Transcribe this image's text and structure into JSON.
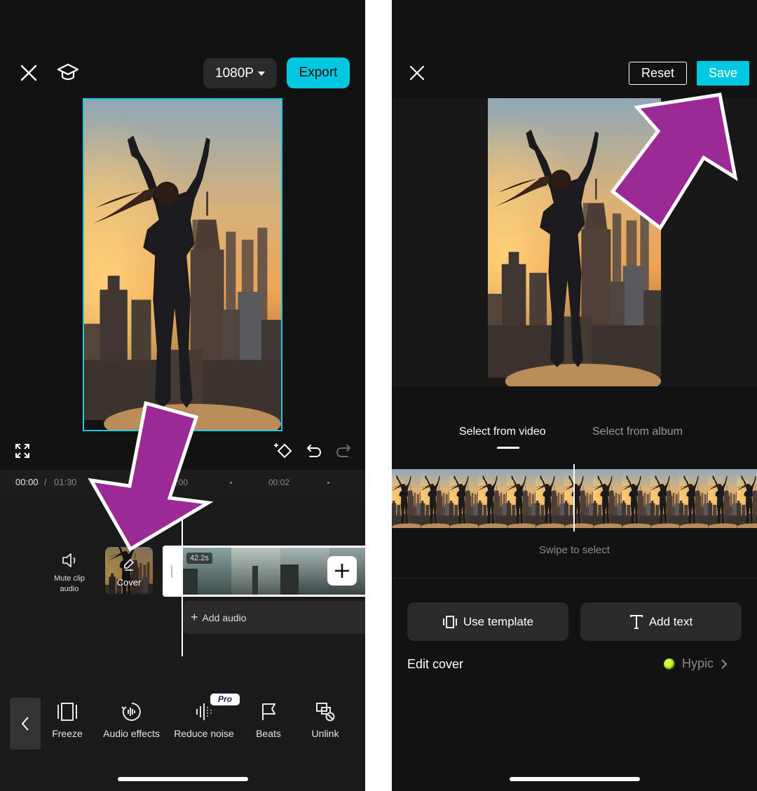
{
  "editor": {
    "resolution": "1080P",
    "export_label": "Export",
    "time_current": "00:00",
    "time_separator": "/",
    "time_total": "01:30",
    "tick_1": "00:00",
    "tick_2": "00:02",
    "mute_label": "Mute clip audio",
    "cover_label": "Cover",
    "clip_duration": "42.2s",
    "add_audio_label": "Add audio",
    "toolbar": {
      "freeze": "Freeze",
      "audio_effects": "Audio effects",
      "reduce_noise": "Reduce noise",
      "pro_badge": "Pro",
      "beats": "Beats",
      "unlink": "Unlink"
    }
  },
  "cover_editor": {
    "reset_label": "Reset",
    "save_label": "Save",
    "tabs": [
      {
        "label": "Select from video",
        "active": true
      },
      {
        "label": "Select from album",
        "active": false
      }
    ],
    "swipe_hint": "Swipe to select",
    "use_template_label": "Use template",
    "add_text_label": "Add text",
    "edit_cover_label": "Edit cover",
    "hypic_label": "Hypic"
  },
  "colors": {
    "accent": "#00c8e0",
    "arrow": "#9b2a96",
    "background": "#121212"
  },
  "icons": [
    "close-icon",
    "graduation-cap-icon",
    "fullscreen-icon",
    "keyframe-icon",
    "undo-icon",
    "redo-icon",
    "speaker-icon",
    "edit-pencil-icon",
    "plus-icon",
    "chevron-left-icon",
    "freeze-icon",
    "audio-effects-icon",
    "reduce-noise-icon",
    "beats-flag-icon",
    "unlink-icon",
    "template-icon",
    "text-icon",
    "chevron-right-icon"
  ]
}
